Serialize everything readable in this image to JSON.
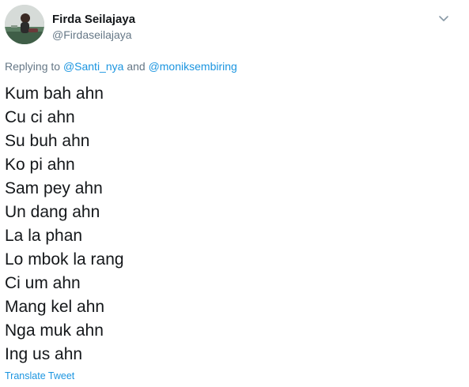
{
  "author": {
    "display_name": "Firda Seilajaya",
    "handle": "@Firdaseilajaya"
  },
  "reply": {
    "prefix": "Replying to",
    "mention1": "@Santi_nya",
    "conjunction": "and",
    "mention2": "@moniksembiring"
  },
  "tweet": {
    "lines": [
      "Kum bah ahn",
      "Cu ci ahn",
      "Su buh ahn",
      "Ko pi ahn",
      "Sam pey ahn",
      "Un dang ahn",
      "La la phan",
      "Lo mbok la rang",
      "Ci um ahn",
      "Mang kel ahn",
      "Nga muk ahn",
      "Ing us ahn"
    ],
    "translate_label": "Translate Tweet"
  },
  "icons": {
    "caret": "chevron-down-icon"
  },
  "colors": {
    "text": "#14171a",
    "secondary": "#657786",
    "link": "#1b95e0"
  }
}
